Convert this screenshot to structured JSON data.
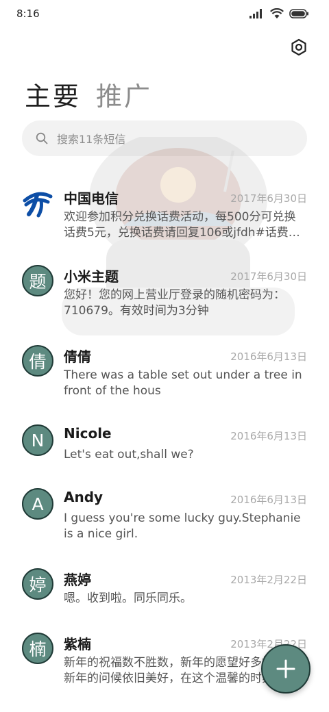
{
  "status_bar": {
    "time": "8:16"
  },
  "tabs": [
    {
      "label": "主要",
      "active": true
    },
    {
      "label": "推广",
      "active": false
    }
  ],
  "search": {
    "placeholder": "搜索11条短信"
  },
  "conversations": [
    {
      "name": "中国电信",
      "date": "2017年6月30日",
      "message": "欢迎参加积分兑换话费活动，每500分可兑换话费5元，兑换话费请回复106或jfdh#话费…",
      "avatar": "china-telecom-logo"
    },
    {
      "name": "小米主题",
      "date": "2017年6月30日",
      "message": "您好！您的网上营业厅登录的随机密码为：710679。有效时间为3分钟",
      "avatar": "题"
    },
    {
      "name": "倩倩",
      "date": "2016年6月13日",
      "message": "There was a table set out under a tree in front of the hous",
      "avatar": "倩"
    },
    {
      "name": "Nicole",
      "date": "2016年6月13日",
      "message": "Let's eat out,shall we?",
      "avatar": "N"
    },
    {
      "name": "Andy",
      "date": "2016年6月13日",
      "message": "I guess you're some lucky guy.Stephanie is a nice girl.",
      "avatar": "A"
    },
    {
      "name": "燕婷",
      "date": "2013年2月22日",
      "message": "嗯。收到啦。同乐同乐。",
      "avatar": "婷"
    },
    {
      "name": "紫楠",
      "date": "2013年2月22日",
      "message": "新年的祝福数不胜数，新年的愿望好多好多，新年的问候依旧美好，在这个温馨的时刻",
      "avatar": "楠"
    }
  ],
  "colors": {
    "accent": "#5d8a80",
    "avatar_border": "#1f3a36",
    "telecom_blue": "#0d4ea6"
  },
  "icons": {
    "settings": "hexagon-settings-icon",
    "search": "search-icon",
    "fab": "plus-icon"
  }
}
